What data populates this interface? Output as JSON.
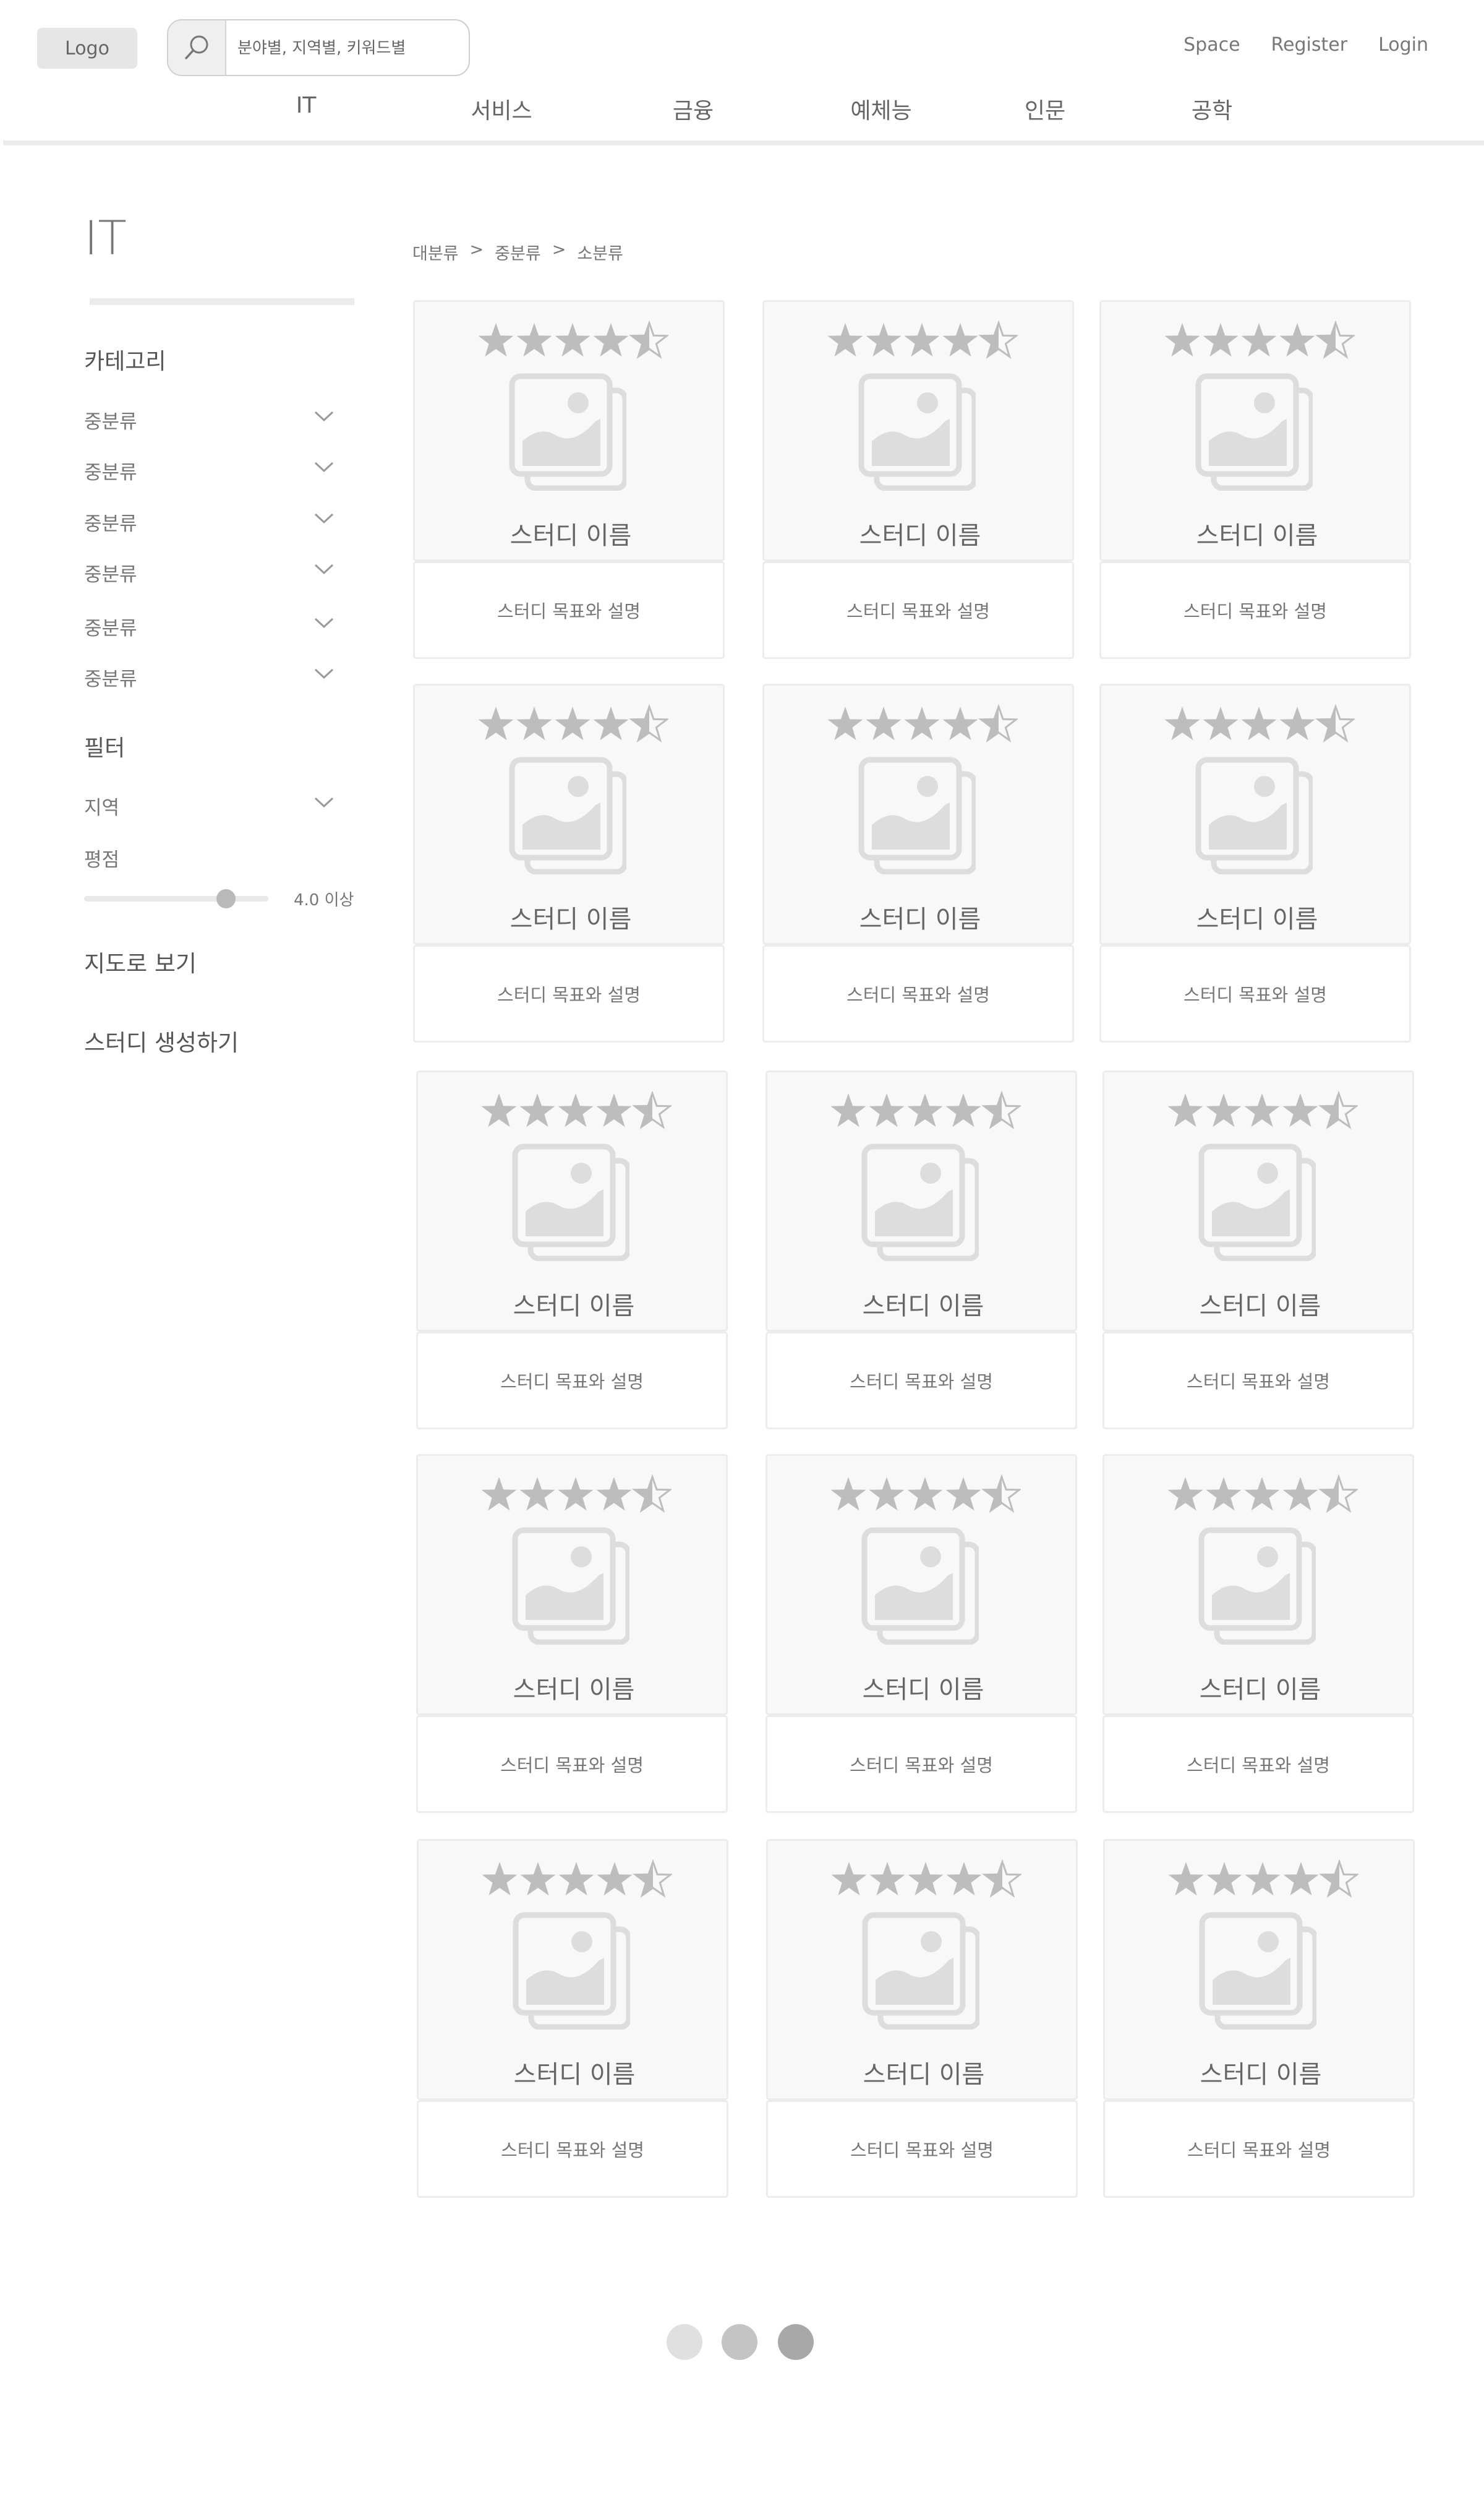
{
  "header": {
    "logo": "Logo",
    "search_placeholder": "분야별, 지역별, 키워드별",
    "links": [
      "Space",
      "Register",
      "Login"
    ]
  },
  "nav": [
    "IT",
    "서비스",
    "금융",
    "예체능",
    "인문",
    "공학"
  ],
  "sidebar": {
    "title": "IT",
    "category_heading": "카테고리",
    "categories": [
      "중분류",
      "중분류",
      "중분류",
      "중분류",
      "중분류",
      "중분류"
    ],
    "filter_heading": "필터",
    "region_label": "지역",
    "rating_label": "평점",
    "rating_min": 4.0,
    "rating_value_text": "4.0 이상",
    "map_link": "지도로 보기",
    "create_link": "스터디 생성하기"
  },
  "breadcrumb": [
    "대분류",
    ">",
    "중분류",
    ">",
    "소분류"
  ],
  "cards": {
    "name": "스터디 이름",
    "description": "스터디 목표와 설명",
    "rating": 4.5,
    "count": 15
  },
  "pagination": {
    "pages": 3,
    "colors": [
      "#e0e0e0",
      "#c4c4c4",
      "#a8a8a8"
    ]
  },
  "icons": {
    "search": "search-icon",
    "chevron": "chevron-down-icon",
    "star": "star-icon",
    "image": "image-placeholder-icon"
  }
}
